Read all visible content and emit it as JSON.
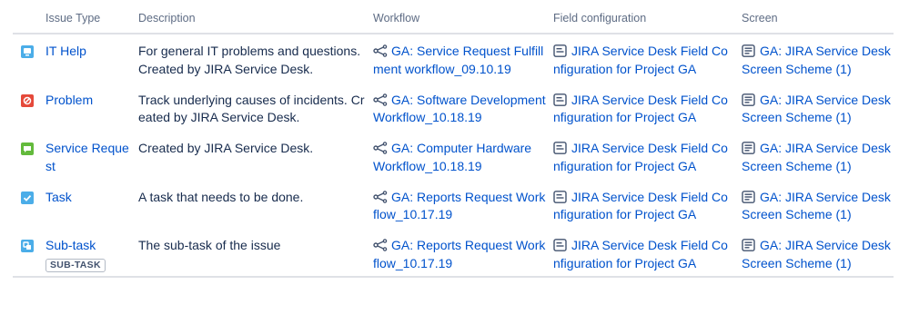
{
  "headers": {
    "issue_type": "Issue Type",
    "description": "Description",
    "workflow": "Workflow",
    "field_configuration": "Field configuration",
    "screen": "Screen"
  },
  "rows": [
    {
      "icon": "it-help-icon",
      "icon_color": "#4bade8",
      "type": "IT Help",
      "description": "For general IT problems and questions. Created by JIRA Service Desk.",
      "workflow": "GA: Service Request Fulfillment workflow_09.10.19",
      "field_configuration": "JIRA Service Desk Field Configuration for Project GA",
      "screen": "GA: JIRA Service Desk Screen Scheme (1)"
    },
    {
      "icon": "problem-icon",
      "icon_color": "#e5493a",
      "type": "Problem",
      "description": "Track underlying causes of incidents. Created by JIRA Service Desk.",
      "workflow": "GA: Software Development Workflow_10.18.19",
      "field_configuration": "JIRA Service Desk Field Configuration for Project GA",
      "screen": "GA: JIRA Service Desk Screen Scheme (1)"
    },
    {
      "icon": "service-request-icon",
      "icon_color": "#63ba3c",
      "type": "Service Request",
      "description": "Created by JIRA Service Desk.",
      "workflow": "GA: Computer Hardware Workflow_10.18.19",
      "field_configuration": "JIRA Service Desk Field Configuration for Project GA",
      "screen": "GA: JIRA Service Desk Screen Scheme (1)"
    },
    {
      "icon": "task-icon",
      "icon_color": "#4bade8",
      "type": "Task",
      "description": "A task that needs to be done.",
      "workflow": "GA: Reports Request Workflow_10.17.19",
      "field_configuration": "JIRA Service Desk Field Configuration for Project GA",
      "screen": "GA: JIRA Service Desk Screen Scheme (1)"
    },
    {
      "icon": "sub-task-icon",
      "icon_color": "#4bade8",
      "type": "Sub-task",
      "badge": "SUB-TASK",
      "description": "The sub-task of the issue",
      "workflow": "GA: Reports Request Workflow_10.17.19",
      "field_configuration": "JIRA Service Desk Field Configuration for Project GA",
      "screen": "GA: JIRA Service Desk Screen Scheme (1)"
    }
  ]
}
